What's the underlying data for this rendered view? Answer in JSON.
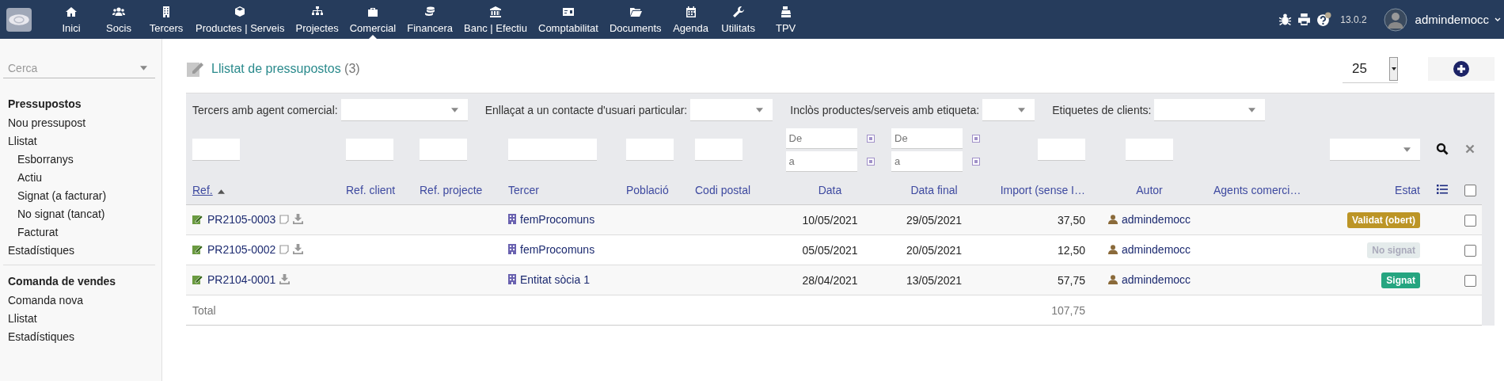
{
  "top_nav": {
    "items": [
      {
        "label": "Inici",
        "selected": false
      },
      {
        "label": "Socis",
        "selected": false
      },
      {
        "label": "Tercers",
        "selected": false
      },
      {
        "label": "Productes | Serveis",
        "selected": false
      },
      {
        "label": "Projectes",
        "selected": false
      },
      {
        "label": "Comercial",
        "selected": true
      },
      {
        "label": "Financera",
        "selected": false
      },
      {
        "label": "Banc | Efectiu",
        "selected": false
      },
      {
        "label": "Comptabilitat",
        "selected": false
      },
      {
        "label": "Documents",
        "selected": false
      },
      {
        "label": "Agenda",
        "selected": false
      },
      {
        "label": "Utilitats",
        "selected": false
      },
      {
        "label": "TPV",
        "selected": false
      }
    ],
    "version": "13.0.2",
    "user": "admindemocc"
  },
  "sidebar": {
    "search": {
      "placeholder": "Cerca"
    },
    "sections": [
      {
        "title": "Pressupostos",
        "items": [
          {
            "label": "Nou pressupost"
          },
          {
            "label": "Llistat",
            "children": [
              {
                "label": "Esborranys"
              },
              {
                "label": "Actiu"
              },
              {
                "label": "Signat (a facturar)"
              },
              {
                "label": "No signat (tancat)"
              },
              {
                "label": "Facturat"
              }
            ]
          },
          {
            "label": "Estadístiques"
          }
        ]
      },
      {
        "title": "Comanda de vendes",
        "items": [
          {
            "label": "Comanda nova"
          },
          {
            "label": "Llistat"
          },
          {
            "label": "Estadístiques"
          }
        ]
      }
    ]
  },
  "page": {
    "title": "Llistat de pressupostos",
    "count": "(3)",
    "page_size": "25"
  },
  "filters": [
    {
      "label": "Tercers amb agent comercial:"
    },
    {
      "label": "Enllaçat a un contacte d'usuari particular:"
    },
    {
      "label": "Inclòs productes/serveis amb etiqueta:"
    },
    {
      "label": "Etiquetes de clients:"
    }
  ],
  "table": {
    "columns": [
      {
        "label": "Ref.",
        "sorted": true,
        "kind": "text"
      },
      {
        "label": "Ref. client",
        "sorted": false,
        "kind": "text"
      },
      {
        "label": "Ref. projecte",
        "sorted": false,
        "kind": "text"
      },
      {
        "label": "Tercer",
        "sorted": false,
        "kind": "wide"
      },
      {
        "label": "Població",
        "sorted": false,
        "kind": "text"
      },
      {
        "label": "Codi postal",
        "sorted": false,
        "kind": "text"
      },
      {
        "label": "Data",
        "sorted": false,
        "kind": "date",
        "placeholders": [
          "De",
          "a"
        ]
      },
      {
        "label": "Data final",
        "sorted": false,
        "kind": "date",
        "placeholders": [
          "De",
          "a"
        ]
      },
      {
        "label": "Import (sense I…",
        "sorted": false,
        "kind": "text"
      },
      {
        "label": "Autor",
        "sorted": false,
        "kind": "text"
      },
      {
        "label": "Agents comerci…",
        "sorted": false,
        "kind": "none"
      },
      {
        "label": "Estat",
        "sorted": false,
        "kind": "select"
      }
    ],
    "select_all": {
      "checked": false
    },
    "rows": [
      {
        "ref": "PR2105-0003",
        "note": true,
        "tercer": "femProcomuns",
        "data": "10/05/2021",
        "data_final": "29/05/2021",
        "import": "37,50",
        "autor": "admindemocc",
        "status": {
          "label": "Validat (obert)",
          "kind": "validated"
        },
        "checked": false
      },
      {
        "ref": "PR2105-0002",
        "note": true,
        "tercer": "femProcomuns",
        "data": "05/05/2021",
        "data_final": "20/05/2021",
        "import": "12,50",
        "autor": "admindemocc",
        "status": {
          "label": "No signat",
          "kind": "not_signed"
        },
        "checked": false
      },
      {
        "ref": "PR2104-0001",
        "note": false,
        "tercer": "Entitat sòcia 1",
        "data": "28/04/2021",
        "data_final": "13/05/2021",
        "import": "57,75",
        "autor": "admindemocc",
        "status": {
          "label": "Signat",
          "kind": "signed"
        },
        "checked": false
      }
    ],
    "total": {
      "label": "Total",
      "import": "107,75"
    }
  }
}
